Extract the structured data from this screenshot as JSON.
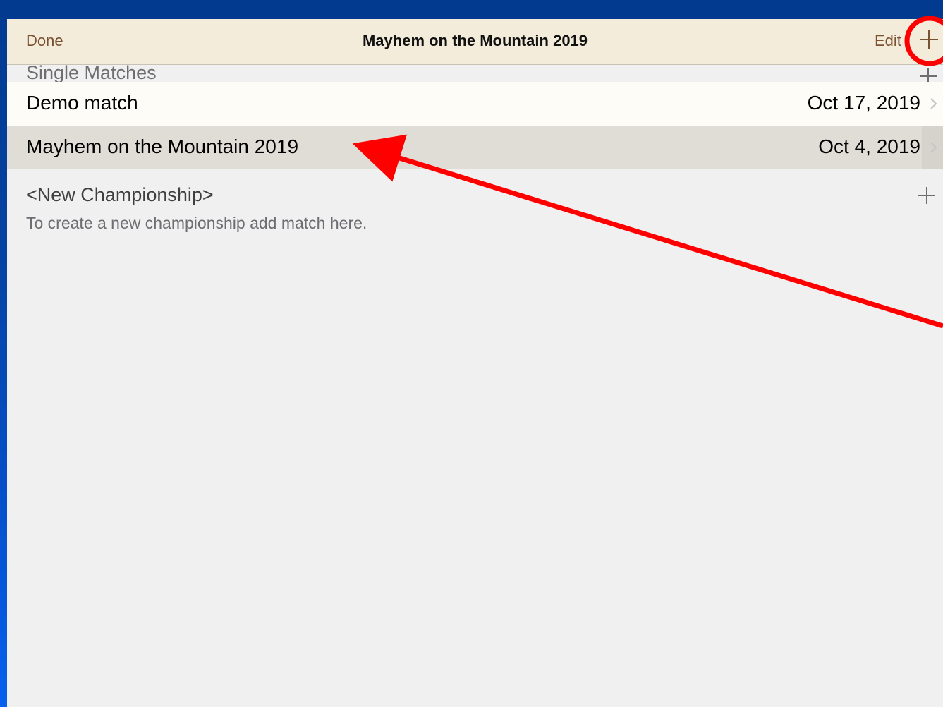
{
  "navbar": {
    "done_label": "Done",
    "title": "Mayhem on the Mountain 2019",
    "edit_label": "Edit",
    "add_icon": "plus-icon"
  },
  "single_matches": {
    "header": "Single Matches",
    "add_icon": "plus-icon",
    "rows": [
      {
        "title": "Demo match",
        "date": "Oct 17, 2019",
        "selected": false
      },
      {
        "title": "Mayhem on the Mountain 2019",
        "date": "Oct 4, 2019",
        "selected": true
      }
    ]
  },
  "new_championship": {
    "title": "<New Championship>",
    "subtitle": "To create a new championship add match here.",
    "add_icon": "plus-icon"
  },
  "annotations": {
    "color": "#ff0000",
    "circle_target": "navbar-add-button",
    "arrow_target": "match-row-mayhem"
  },
  "colors": {
    "background": "#0444a6",
    "navbar": "#f4ecdb",
    "accent": "#7a5232",
    "selected_row": "#e0ddd6"
  }
}
